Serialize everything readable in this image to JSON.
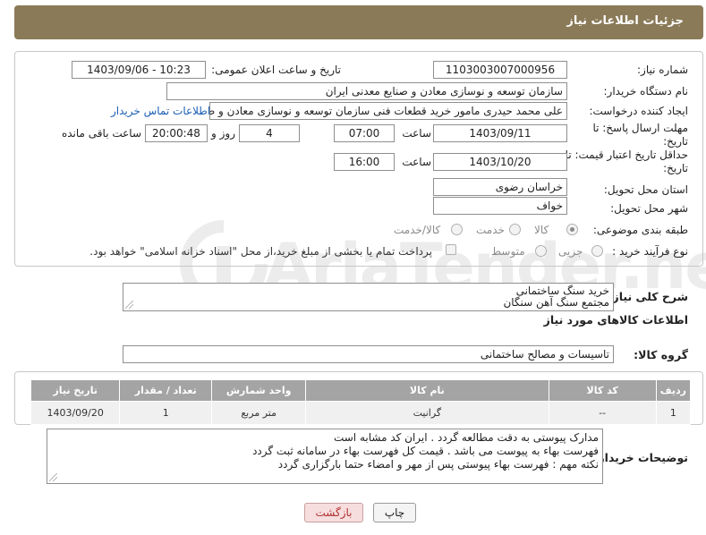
{
  "header": {
    "title": "جزئیات اطلاعات نیاز"
  },
  "form": {
    "need_number": {
      "label": "شماره نیاز:",
      "value": "1103003007000956"
    },
    "announce": {
      "label": "تاریخ و ساعت اعلان عمومی:",
      "value": "1403/09/06 - 10:23"
    },
    "buyer_org": {
      "label": "نام دستگاه خریدار:",
      "value": "سازمان توسعه و نوسازی معادن و صنایع معدنی ایران"
    },
    "creator": {
      "label": "ایجاد کننده درخواست:",
      "value": "علی محمد حیدری مامور خرید قطعات فنی سازمان توسعه و نوسازی معادن و ص",
      "contact_link": "اطلاعات تماس خریدار"
    },
    "reply_deadline": {
      "label_line1": "مهلت ارسال پاسخ: تا",
      "label_line2": "تاریخ:",
      "date": "1403/09/11",
      "time_label": "ساعت",
      "time": "07:00",
      "days": "4",
      "days_label": "روز و",
      "remaining": "20:00:48",
      "remaining_label": "ساعت باقی مانده"
    },
    "validity": {
      "label_line1": "حداقل تاریخ اعتبار قیمت: تا",
      "label_line2": "تاریخ:",
      "date": "1403/10/20",
      "time_label": "ساعت",
      "time": "16:00"
    },
    "province": {
      "label": "استان محل تحویل:",
      "value": "خراسان رضوی"
    },
    "city": {
      "label": "شهر محل تحویل:",
      "value": "خواف"
    },
    "category": {
      "label": "طبقه بندی موضوعی:",
      "options": [
        "کالا",
        "خدمت",
        "کالا/خدمت"
      ],
      "selected": "کالا"
    },
    "process": {
      "label": "نوع فرآیند خرید :",
      "options": [
        "جزیی",
        "متوسط"
      ],
      "payment_note": "پرداخت تمام یا بخشی از مبلغ خرید،از محل \"اسناد خزانه اسلامی\" خواهد بود."
    }
  },
  "description": {
    "label": "شرح کلی نیاز:",
    "lines": [
      "خرید سنگ ساختمانی",
      "مجتمع سنگ آهن سنگان"
    ]
  },
  "goods_info": {
    "title": "اطلاعات کالاهای مورد نیاز",
    "group_label": "گروه کالا:",
    "group_value": "تاسیسات و مصالح ساختمانی"
  },
  "table": {
    "headers": [
      "ردیف",
      "کد کالا",
      "نام کالا",
      "واحد شمارش",
      "تعداد / مقدار",
      "تاریخ نیاز"
    ],
    "rows": [
      [
        "1",
        "--",
        "گرانیت",
        "متر مربع",
        "1",
        "1403/09/20"
      ]
    ]
  },
  "buyer_notes": {
    "label": "توضیحات خریدار:",
    "lines": [
      "مدارک پیوستی به دقت مطالعه گردد . ایران کد مشابه است",
      "فهرست بهاء به پیوست می باشد . قیمت کل فهرست بهاء در سامانه ثبت گردد",
      "نکته مهم : فهرست بهاء پیوستی پس از مهر و امضاء حتما بارگزاری گردد"
    ]
  },
  "buttons": {
    "print": "چاپ",
    "back": "بازگشت"
  },
  "watermark": {
    "text": "AriaTender.neT"
  },
  "colors": {
    "header_bg": "#8a7a58",
    "link": "#1a5fb4",
    "table_header": "#a4a4a4",
    "back_btn": "#f7dede"
  }
}
